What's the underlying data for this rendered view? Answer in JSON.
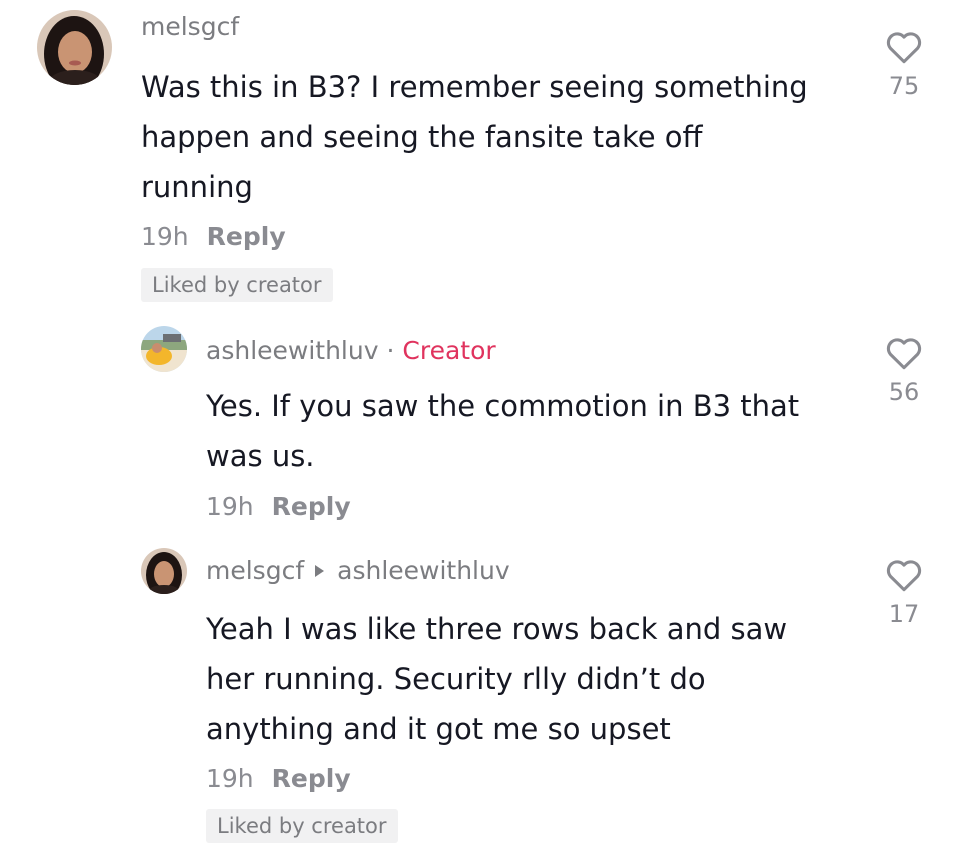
{
  "comments": [
    {
      "username": "melsgcf",
      "text_lines": [
        "Was this in B3? I remember seeing something",
        "happen and seeing the fansite take off",
        "running"
      ],
      "time": "19h",
      "reply_label": "Reply",
      "liked_badge": "Liked by creator",
      "likes": "75",
      "avatar_icon": "avatar-woman-dark-hair"
    },
    {
      "username": "ashleewithluv",
      "separator": "·",
      "creator_label": "Creator",
      "text_lines": [
        "Yes. If you saw the commotion in B3 that",
        "was us."
      ],
      "time": "19h",
      "reply_label": "Reply",
      "likes": "56",
      "avatar_icon": "avatar-outdoor-photo"
    },
    {
      "username": "melsgcf",
      "reply_to": "ashleewithluv",
      "text_lines": [
        "Yeah I was like three rows back and saw",
        "her running. Security rlly didn’t do",
        "anything and it got me so upset"
      ],
      "time": "19h",
      "reply_label": "Reply",
      "liked_badge": "Liked by creator",
      "likes": "17",
      "avatar_icon": "avatar-woman-dark-hair"
    }
  ],
  "colors": {
    "creator": "#e0335e",
    "secondary_text": "#7b7c80",
    "primary_text": "#161823",
    "badge_bg": "#f1f1f2"
  },
  "icons": {
    "like": "heart-outline-icon"
  }
}
